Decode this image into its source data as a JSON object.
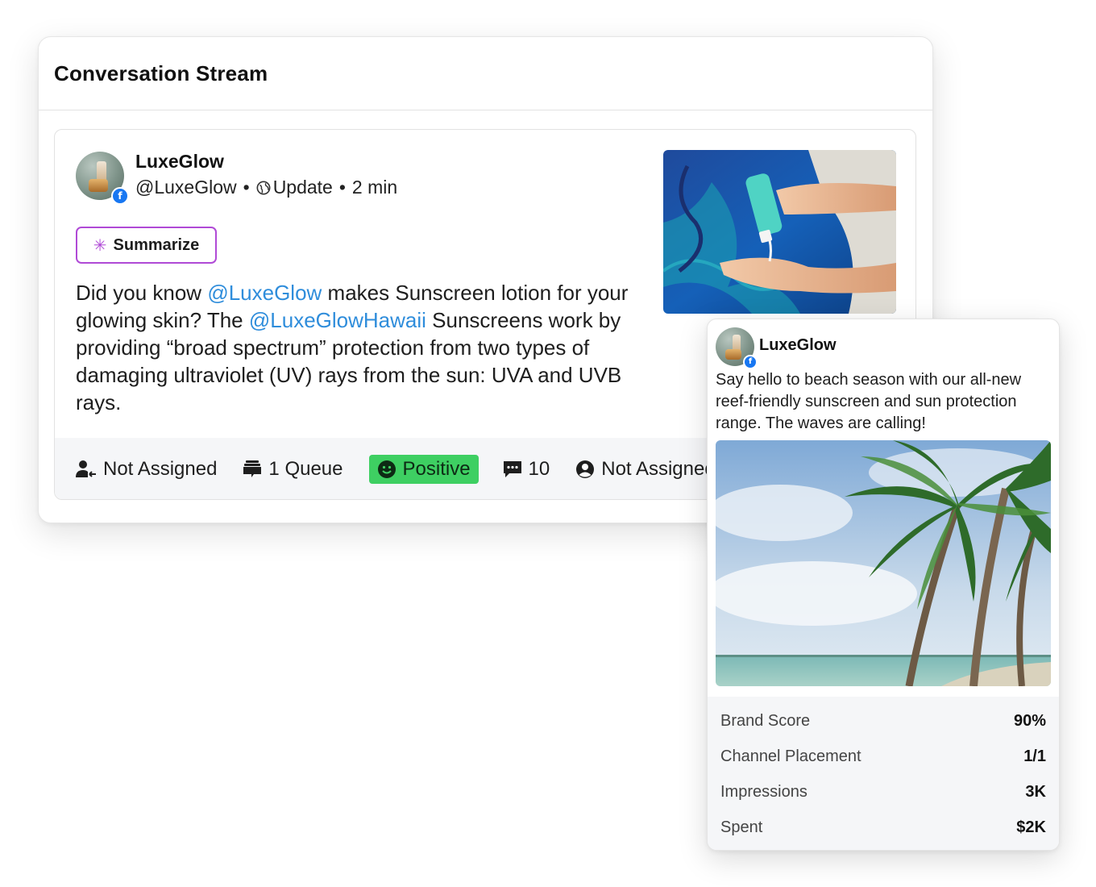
{
  "stream": {
    "title": "Conversation Stream"
  },
  "post": {
    "author_name": "LuxeGlow",
    "handle": "@LuxeGlow",
    "separator": "•",
    "post_type": "Update",
    "time_ago": "2 min",
    "summarize_label": "Summarize",
    "text": {
      "part1": "Did you know ",
      "mention1": "@LuxeGlow",
      "part2": " makes Sunscreen lotion for your glowing skin? The ",
      "mention2": "@LuxeGlowHawaii",
      "part3": " Sunscreens work by providing “broad spectrum” protection from two types of damaging ultraviolet (UV) rays from the sun: UVA and UVB rays."
    },
    "image_icon": "sunscreen-photo",
    "footer": {
      "assignee": "Not Assigned",
      "queue": "1 Queue",
      "sentiment": "Positive",
      "comments": "10",
      "owner": "Not Assigned"
    }
  },
  "ad": {
    "author_name": "LuxeGlow",
    "text": "Say hello to beach season with our all-new reef-friendly sunscreen and sun protection range. The waves are calling!",
    "image_icon": "palm-beach-photo",
    "metrics": [
      {
        "label": "Brand Score",
        "value": "90%"
      },
      {
        "label": "Channel Placement",
        "value": "1/1"
      },
      {
        "label": "Impressions",
        "value": "3K"
      },
      {
        "label": "Spent",
        "value": "$2K"
      }
    ]
  },
  "colors": {
    "mention": "#2f8ddb",
    "summarize_border": "#b04ad6",
    "positive": "#3ecf62",
    "facebook": "#1877f2"
  }
}
